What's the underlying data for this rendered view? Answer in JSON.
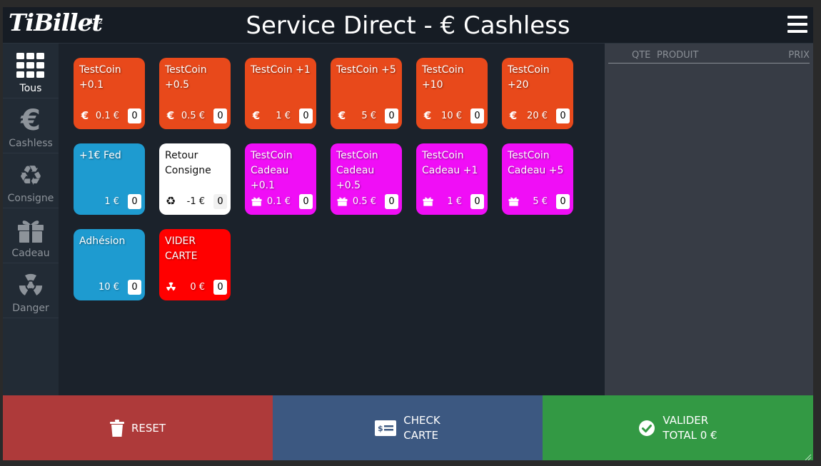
{
  "header": {
    "logo": "TiBillet",
    "logo_count": "112",
    "title": "Service Direct - € Cashless"
  },
  "sidebar": {
    "items": [
      {
        "label": "Tous",
        "icon": "grid-icon",
        "active": true
      },
      {
        "label": "Cashless",
        "icon": "euro-icon",
        "active": false
      },
      {
        "label": "Consigne",
        "icon": "recycle-icon",
        "active": false
      },
      {
        "label": "Cadeau",
        "icon": "gift-icon",
        "active": false
      },
      {
        "label": "Danger",
        "icon": "radiation-icon",
        "active": false
      }
    ]
  },
  "products": [
    {
      "name": "TestCoin +0.1",
      "price": "0.1 €",
      "qty": "0",
      "icon": "euro-icon",
      "color": "#e8491b"
    },
    {
      "name": "TestCoin +0.5",
      "price": "0.5 €",
      "qty": "0",
      "icon": "euro-icon",
      "color": "#e8491b"
    },
    {
      "name": "TestCoin +1",
      "price": "1 €",
      "qty": "0",
      "icon": "euro-icon",
      "color": "#e8491b"
    },
    {
      "name": "TestCoin +5",
      "price": "5 €",
      "qty": "0",
      "icon": "euro-icon",
      "color": "#e8491b"
    },
    {
      "name": "TestCoin +10",
      "price": "10 €",
      "qty": "0",
      "icon": "euro-icon",
      "color": "#e8491b"
    },
    {
      "name": "TestCoin +20",
      "price": "20 €",
      "qty": "0",
      "icon": "euro-icon",
      "color": "#e8491b"
    },
    {
      "name": "+1€ Fed",
      "price": "1 €",
      "qty": "0",
      "icon": "",
      "color": "#1e9bd0"
    },
    {
      "name": "Retour Consigne",
      "price": "-1 €",
      "qty": "0",
      "icon": "recycle-icon",
      "color": "#ffffff"
    },
    {
      "name": "TestCoin Cadeau +0.1",
      "price": "0.1 €",
      "qty": "0",
      "icon": "gift-icon",
      "color": "#f00ef6"
    },
    {
      "name": "TestCoin Cadeau +0.5",
      "price": "0.5 €",
      "qty": "0",
      "icon": "gift-icon",
      "color": "#f00ef6"
    },
    {
      "name": "TestCoin Cadeau +1",
      "price": "1 €",
      "qty": "0",
      "icon": "gift-icon",
      "color": "#f00ef6"
    },
    {
      "name": "TestCoin Cadeau +5",
      "price": "5 €",
      "qty": "0",
      "icon": "gift-icon",
      "color": "#f00ef6"
    },
    {
      "name": "Adhésion",
      "price": "10 €",
      "qty": "0",
      "icon": "",
      "color": "#1e9bd0"
    },
    {
      "name": "VIDER CARTE",
      "price": "0 €",
      "qty": "0",
      "icon": "radiation-icon",
      "color": "#ff0000"
    }
  ],
  "panel": {
    "col_qty": "QTE",
    "col_product": "PRODUIT",
    "col_price": "PRIX"
  },
  "buttons": {
    "reset": "RESET",
    "check_line1": "CHECK",
    "check_line2": "CARTE",
    "valid_line1": "VALIDER",
    "valid_line2": "TOTAL 0 €"
  }
}
